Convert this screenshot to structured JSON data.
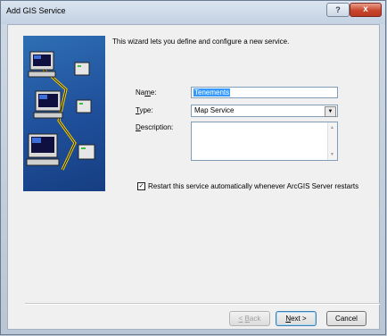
{
  "window": {
    "title": "Add GIS Service",
    "help_glyph": "?",
    "close_glyph": "x"
  },
  "intro_text": "This wizard lets you define and configure a new service.",
  "form": {
    "name_label": "Name:",
    "name_value": "Tenements",
    "type_label": "Type:",
    "type_value": "Map Service",
    "description_label": "Description:",
    "description_value": "",
    "restart_label": "Restart this service automatically whenever ArcGIS Server restarts",
    "restart_checked": true
  },
  "buttons": {
    "back": "< Back",
    "next": "Next >",
    "cancel": "Cancel"
  },
  "colors": {
    "art_background": "#1f4f9a",
    "selection": "#3399ff",
    "close_button": "#c9462c"
  }
}
